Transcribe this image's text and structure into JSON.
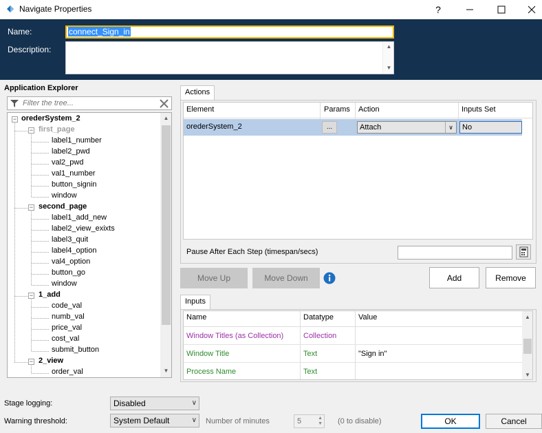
{
  "window": {
    "title": "Navigate Properties",
    "help": "?",
    "minimize": "—",
    "maximize": "☐",
    "close": "✕"
  },
  "header": {
    "name_label": "Name:",
    "name_value": "connect_Sign_in",
    "description_label": "Description:"
  },
  "explorer": {
    "title": "Application Explorer",
    "filter_placeholder": "Filter the tree...",
    "tree": {
      "root": "orederSystem_2",
      "g1": "first_page",
      "g1_items": [
        "label1_number",
        "label2_pwd",
        "val2_pwd",
        "val1_number",
        "button_signin",
        "window"
      ],
      "g2": "second_page",
      "g2_items": [
        "label1_add_new",
        "label2_view_exixts",
        "label3_quit",
        "label4_option",
        "val4_option",
        "button_go",
        "window"
      ],
      "g3": "1_add",
      "g3_items": [
        "code_val",
        "numb_val",
        "price_val",
        "cost_val",
        "submit_button"
      ],
      "g4": "2_view",
      "g4_items": [
        "order_val"
      ]
    }
  },
  "actions": {
    "tab": "Actions",
    "headers": {
      "element": "Element",
      "params": "Params",
      "action": "Action",
      "inputs_set": "Inputs Set"
    },
    "row": {
      "element": "orederSystem_2",
      "params": "...",
      "action": "Attach",
      "inputs_set": "No"
    },
    "pause_label": "Pause After Each Step (timespan/secs)",
    "pause_value": "",
    "move_up": "Move Up",
    "move_down": "Move Down",
    "add": "Add",
    "remove": "Remove"
  },
  "inputs": {
    "tab": "Inputs",
    "headers": {
      "name": "Name",
      "datatype": "Datatype",
      "value": "Value"
    },
    "rows": [
      {
        "name": "Window Titles (as Collection)",
        "datatype": "Collection",
        "value": "",
        "color": "#9b30a8"
      },
      {
        "name": "Window Title",
        "datatype": "Text",
        "value": "\"Sign in\"",
        "color": "#2e8b2e"
      },
      {
        "name": "Process Name",
        "datatype": "Text",
        "value": "",
        "color": "#2e8b2e"
      }
    ]
  },
  "footer": {
    "stage_logging_label": "Stage logging:",
    "stage_logging_value": "Disabled",
    "warning_label": "Warning threshold:",
    "warning_value": "System Default",
    "minutes_label": "Number of minutes",
    "minutes_value": "5",
    "disable_hint": "(0 to disable)",
    "ok": "OK",
    "cancel": "Cancel"
  },
  "colors": {
    "header_bg": "#14314f",
    "selection": "#b7cde8",
    "focus": "#f2b400",
    "ok_border": "#0078d7"
  }
}
